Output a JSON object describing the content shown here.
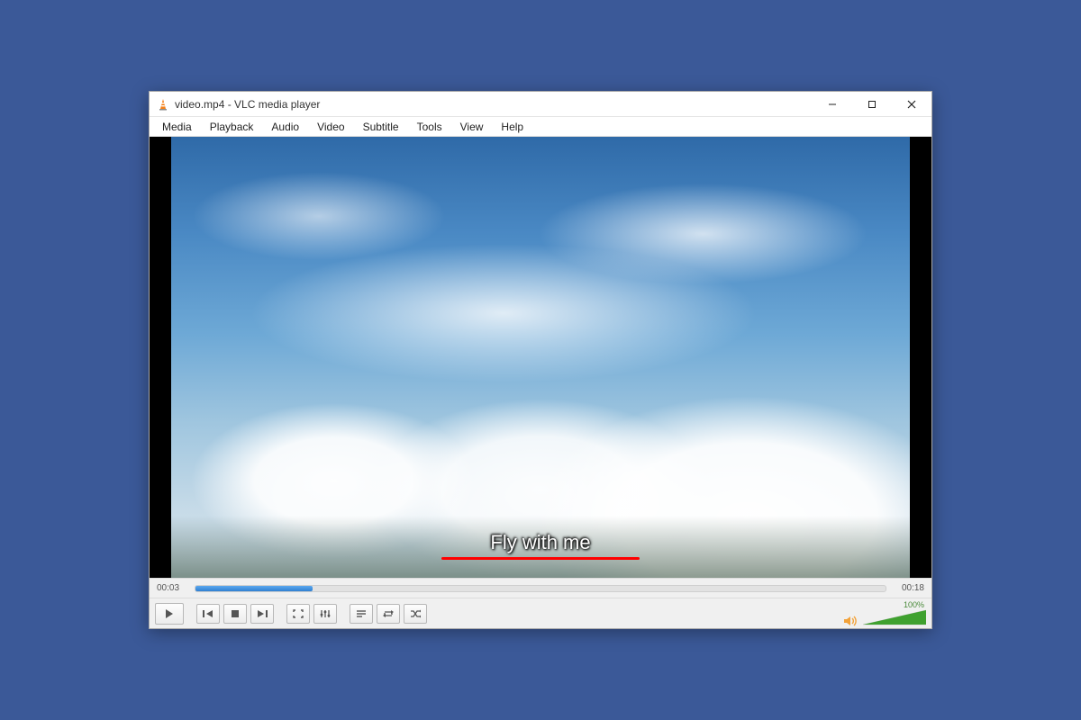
{
  "window": {
    "title": "video.mp4 - VLC media player"
  },
  "menu": {
    "items": [
      "Media",
      "Playback",
      "Audio",
      "Video",
      "Subtitle",
      "Tools",
      "View",
      "Help"
    ]
  },
  "subtitle": {
    "text": "Fly with me"
  },
  "playback": {
    "elapsed": "00:03",
    "total": "00:18",
    "progress_percent": 17
  },
  "volume": {
    "label": "100%",
    "level_percent": 100
  },
  "icons": {
    "app": "vlc-cone-icon",
    "minimize": "minimize-icon",
    "maximize": "maximize-icon",
    "close": "close-icon",
    "play": "play-icon",
    "prev": "previous-icon",
    "stop": "stop-icon",
    "next": "next-icon",
    "fullscreen": "fullscreen-icon",
    "ext": "extended-settings-icon",
    "playlist": "playlist-icon",
    "loop": "loop-icon",
    "shuffle": "shuffle-icon",
    "speaker": "speaker-icon"
  }
}
